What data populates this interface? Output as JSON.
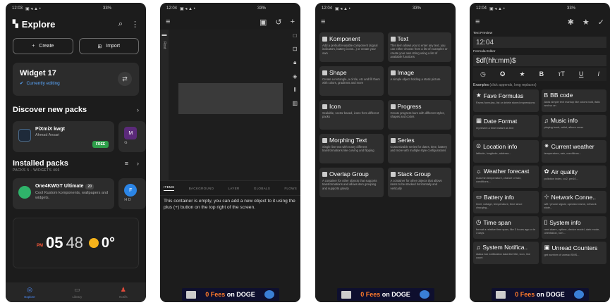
{
  "p1": {
    "status_time": "12:03",
    "status_right": "33%",
    "title": "Explore",
    "create_label": "Create",
    "import_label": "Import",
    "widget_name": "Widget 17",
    "widget_status": "Currently editing",
    "discover_title": "Discover new packs",
    "discover_packs": [
      {
        "name": "PiXmiX kwgt",
        "author": "Ahmad Ansari",
        "badge": "FREE",
        "color": "#1e2a3a"
      },
      {
        "name": "M",
        "author": "G",
        "color": "#5b2a7a"
      }
    ],
    "installed_title": "Installed packs",
    "installed_sub": "PACKS 5 - WIDGETS 466",
    "installed_packs": [
      {
        "name": "One4KWGT Ultimate",
        "ver": "20",
        "desc": "Cool Kustom komponents, wallpapers and widgets.",
        "color": "#2fb36a"
      },
      {
        "name": "F",
        "desc": "H D",
        "color": "#2b85e6"
      }
    ],
    "clock_pm": "PM",
    "clock_hour": "05",
    "clock_min": "48",
    "temp": "0°",
    "nav": {
      "explore": "Explore",
      "library": "Library",
      "notifs": "Notifs"
    }
  },
  "p2": {
    "status_time": "12:04",
    "status_right": "33%",
    "root_label": "Root",
    "tabs": [
      "ITEMS",
      "BACKGROUND",
      "LAYER",
      "GLOBALS",
      "FLOWS"
    ],
    "empty_text": "This container is empty, you can add a new object to it using the plus (+) button on the top right of the screen."
  },
  "p3": {
    "status_time": "12:04",
    "status_right": "33%",
    "items": [
      {
        "title": "Komponent",
        "desc": "Add a prebuilt reusable component (signal indicators, battery icons...) or create your own"
      },
      {
        "title": "Text",
        "desc": "This item allows you to enter any text, you can either choose from a list of examples or create your own string using a list of available functions"
      },
      {
        "title": "Shape",
        "desc": "Create a rectangle, a circle, etc and fill them with colors, gradients and more"
      },
      {
        "title": "Image",
        "desc": "A simple object holding a static picture"
      },
      {
        "title": "Icon",
        "desc": "Scalable, vector based, icons from different packs"
      },
      {
        "title": "Progress",
        "desc": "Create progress bars with different styles, shapes and colors"
      },
      {
        "title": "Morphing Text",
        "desc": "Single line text with many different transformations like curving and flipping"
      },
      {
        "title": "Series",
        "desc": "Customizable series for dates, time, battery and more with multiple style configurations"
      },
      {
        "title": "Overlap Group",
        "desc": "A container for other objects that supports transformations and allows item grouping and supports gravity"
      },
      {
        "title": "Stack Group",
        "desc": "A container for other objects that allows items to be stacked horizontally and vertically"
      }
    ]
  },
  "p4": {
    "status_time": "12:04",
    "status_right": "33%",
    "preview_label": "Text Preview",
    "preview_value": "12:04",
    "formula_label": "Formula Editor",
    "formula_value": "$df(hh:mm)$",
    "examples_label": "Examples",
    "examples_hint": "(click appends, long replaces)",
    "examples": [
      {
        "title": "Fave Formulas",
        "desc": "Faves formulas, list or delete stored expressions"
      },
      {
        "title": "BB code",
        "desc": "Adds simple text markup like colors bold, italic and so on"
      },
      {
        "title": "Date Format",
        "desc": "represent a time instant as text"
      },
      {
        "title": "Music info",
        "desc": "playing track, artist, album cover"
      },
      {
        "title": "Location info",
        "desc": "latitude, longitude, address..."
      },
      {
        "title": "Current weather",
        "desc": "temperature, rain, conditions..."
      },
      {
        "title": "Weather forecast",
        "desc": "max/min temperature, chance of rain, conditions..."
      },
      {
        "title": "Air quality",
        "desc": "pollution index, co2, pm10..."
      },
      {
        "title": "Battery info",
        "desc": "level, voltage, temperature, time since charging..."
      },
      {
        "title": "Network Conne..",
        "desc": "wifi / phone signal, operator name, network state..."
      },
      {
        "title": "Time span",
        "desc": "format a relative time span, like 3 hours ago or in 3 days"
      },
      {
        "title": "System info",
        "desc": "next alarm, uptime, device model, dark mode, orientation, rom..."
      },
      {
        "title": "System Notifica..",
        "desc": "status bar notification data like title, icon, line count"
      },
      {
        "title": "Unread Counters",
        "desc": "get number of unread SMS..."
      }
    ]
  },
  "ad": {
    "pre": "0 Fees",
    "mid": " on ",
    "post": "DOGE"
  }
}
